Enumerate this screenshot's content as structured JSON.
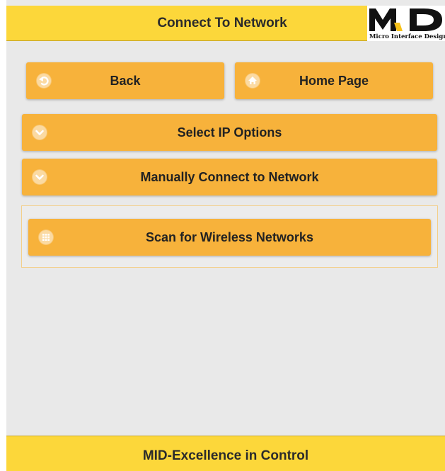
{
  "header": {
    "title": "Connect To Network",
    "logo_text": "Micro Interface Design"
  },
  "nav": {
    "back_label": "Back",
    "home_label": "Home Page"
  },
  "sections": {
    "ip_options_label": "Select IP Options",
    "manual_connect_label": "Manually Connect to Network",
    "scan_label": "Scan for Wireless Networks"
  },
  "icons": {
    "back": "back-arrow-icon",
    "home": "home-icon",
    "ip_options": "chevron-down-icon",
    "manual_connect": "chevron-down-icon",
    "scan": "grid-icon"
  },
  "footer": {
    "text": "MID-Excellence in Control"
  },
  "colors": {
    "header_bg": "#fcd73a",
    "button_bg": "#f7b23b",
    "page_bg": "#e9e9e9"
  }
}
